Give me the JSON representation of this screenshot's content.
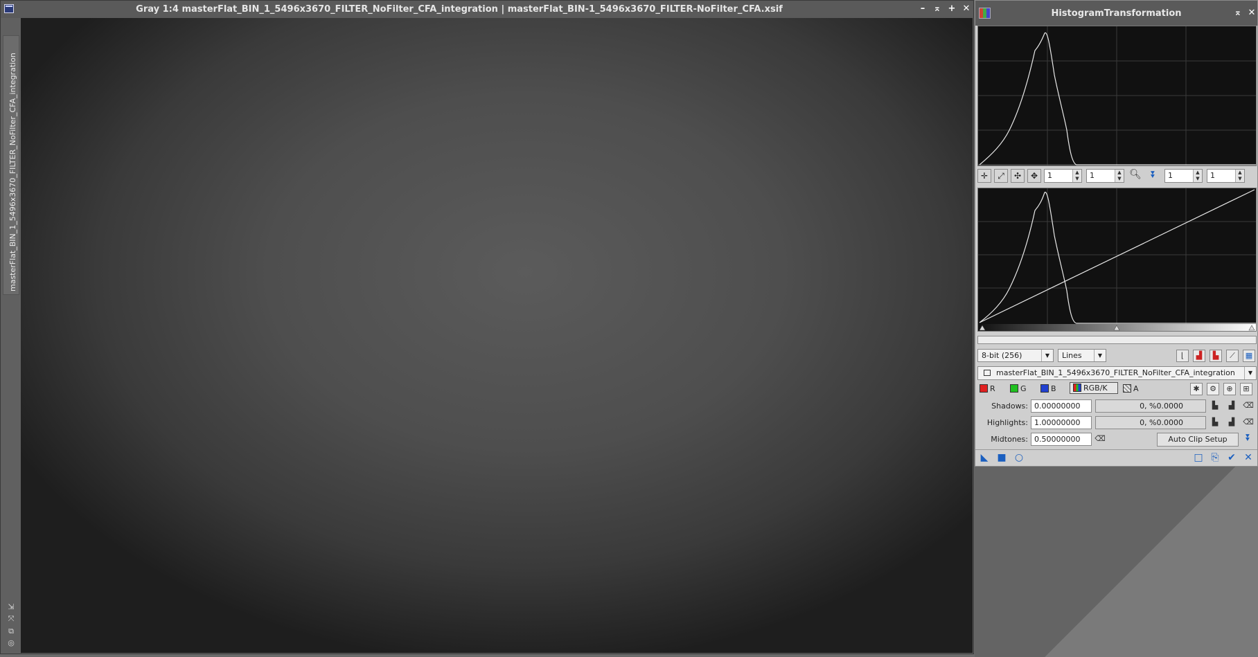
{
  "image_window": {
    "title": "Gray 1:4 masterFlat_BIN_1_5496x3670_FILTER_NoFilter_CFA_integration | masterFlat_BIN-1_5496x3670_FILTER-NoFilter_CFA.xsif",
    "side_tab_label": "masterFlat_BIN_1_5496x3670_FILTER_NoFilter_CFA_integration",
    "buttons": {
      "minimize": "–",
      "shade": "⌅",
      "maximize": "+",
      "close": "✕"
    }
  },
  "histogram_panel": {
    "title": "HistogramTransformation",
    "close_glyph": "✕",
    "shade_glyph": "⌅",
    "zoom": {
      "h1": "1",
      "v1": "1",
      "h2": "1",
      "v2": "1"
    },
    "resolution": "8-bit (256)",
    "graph_style": "Lines",
    "view_selector": "masterFlat_BIN_1_5496x3670_FILTER_NoFilter_CFA_integration",
    "channels": [
      {
        "label": "R",
        "color": "#e02020"
      },
      {
        "label": "G",
        "color": "#20c020"
      },
      {
        "label": "B",
        "color": "#2040d0"
      },
      {
        "label": "RGB/K",
        "color": "#444444"
      },
      {
        "label": "A",
        "color": "#888888"
      }
    ],
    "shadows": {
      "label": "Shadows:",
      "value": "0.00000000",
      "clip": "0, %0.0000"
    },
    "highlights": {
      "label": "Highlights:",
      "value": "1.00000000",
      "clip": "0, %0.0000"
    },
    "midtones": {
      "label": "Midtones:",
      "value": "0.50000000"
    },
    "auto_clip_button": "Auto Clip Setup",
    "accent_color": "#1b5fbf"
  }
}
